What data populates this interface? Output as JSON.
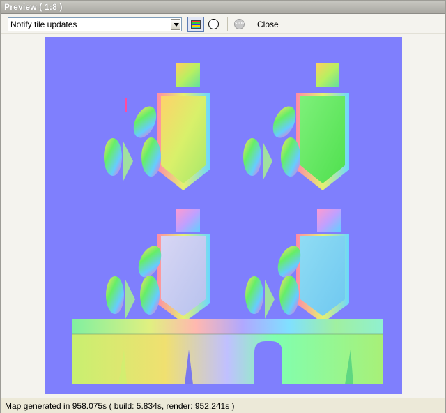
{
  "window": {
    "title": "Preview ( 1:8 )"
  },
  "toolbar": {
    "mode_select": {
      "value": "Notify tile updates"
    },
    "normal_map_button": {
      "icon": "normal-map-icon",
      "active": true
    },
    "sphere_button": {
      "icon": "sphere-icon"
    },
    "stop_button": {
      "icon": "stop-icon",
      "label": "STOP"
    },
    "close_label": "Close"
  },
  "status": {
    "message": "Map generated in 958.075s ( build: 5.834s, render: 952.241s )"
  },
  "colors": {
    "canvas_background": "#7f7ffd",
    "window_background": "#f4f3ee",
    "titlebar": "#b8b7b1",
    "active_button_border": "#5d7cb2"
  }
}
